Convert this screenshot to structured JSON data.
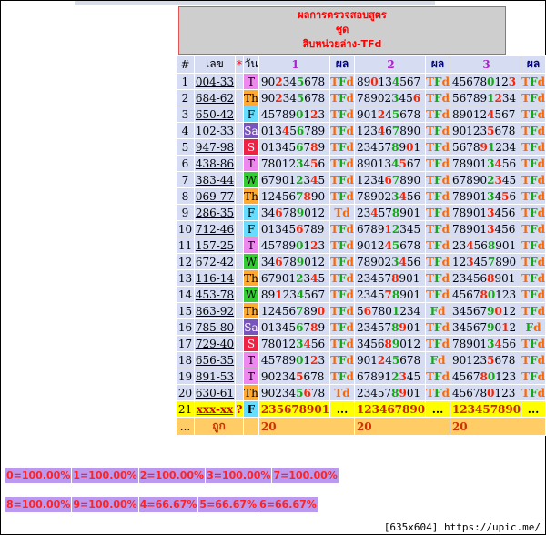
{
  "title": {
    "line1": "ผลการตรวจสอบสูตร",
    "line2": "ชุด",
    "line3": "สิบหน่วยล่าง-TFd"
  },
  "headers": {
    "idx": "#",
    "num": "เลข",
    "star": "*",
    "day": "วัน",
    "set1": "1",
    "score1": "ผล",
    "set2": "2",
    "score2": "ผล",
    "set3": "3",
    "score3": "ผล"
  },
  "colors": {
    "accent_red": "#ff0000",
    "header_bg": "#cecece",
    "row_bg": "#d6ddf3",
    "prediction_bg": "#ffff00",
    "total_bg": "#ffcc66",
    "stat_bg": "#bb99ee"
  },
  "rows": [
    {
      "idx": "1",
      "num": "004-33",
      "day": "T",
      "s1": "902345678",
      "h1": [
        2,
        5
      ],
      "r1": "TFd",
      "s2": "890134567",
      "h2": [
        2,
        5
      ],
      "r2": "TFd",
      "s3": "456780123",
      "h3": [
        8,
        5
      ],
      "r3": "TFd"
    },
    {
      "idx": "2",
      "num": "684-62",
      "day": "Th",
      "s1": "902345678",
      "h1": [
        2,
        5
      ],
      "r1": "TFd",
      "s2": "789023456",
      "h2": [
        8,
        5
      ],
      "r2": "TFd",
      "s3": "567891234",
      "h3": [
        6,
        5
      ],
      "r3": "TFd"
    },
    {
      "idx": "3",
      "num": "650-42",
      "day": "F",
      "s1": "457890123",
      "h1": [
        7,
        5
      ],
      "r1": "TFd",
      "s2": "901245678",
      "h2": [
        3,
        5
      ],
      "r2": "TFd",
      "s3": "890124567",
      "h3": [
        5,
        5
      ],
      "r3": "TFd"
    },
    {
      "idx": "4",
      "num": "102-33",
      "day": "Sa",
      "s1": "013456789",
      "h1": [
        3,
        5
      ],
      "r1": "TFd",
      "s2": "123467890",
      "h2": [
        3,
        5
      ],
      "r2": "TFd",
      "s3": "901235678",
      "h3": [
        5,
        5
      ],
      "r3": "TFd"
    },
    {
      "idx": "5",
      "num": "947-98",
      "day": "S",
      "s1": "013456789",
      "h1": [
        7,
        5
      ],
      "r1": "TFd",
      "s2": "234578901",
      "h2": [
        7,
        5
      ],
      "r2": "TFd",
      "s3": "567891234",
      "h3": [
        4,
        5
      ],
      "r3": "TFd"
    },
    {
      "idx": "6",
      "num": "438-86",
      "day": "T",
      "s1": "780123456",
      "h1": [
        7,
        5
      ],
      "r1": "TFd",
      "s2": "890134567",
      "h2": [
        6,
        5
      ],
      "r2": "TFd",
      "s3": "789013456",
      "h3": [
        6,
        5
      ],
      "r3": "TFd"
    },
    {
      "idx": "7",
      "num": "383-44",
      "day": "W",
      "s1": "679012345",
      "h1": [
        7,
        5
      ],
      "r1": "TFd",
      "s2": "123467890",
      "h2": [
        4,
        5
      ],
      "r2": "TFd",
      "s3": "678902345",
      "h3": [
        6,
        5
      ],
      "r3": "TFd"
    },
    {
      "idx": "8",
      "num": "069-77",
      "day": "Th",
      "s1": "124567890",
      "h1": [
        6,
        5
      ],
      "r1": "TFd",
      "s2": "789023456",
      "h2": [
        6,
        5
      ],
      "r2": "TFd",
      "s3": "789013456",
      "h3": [
        7,
        5
      ],
      "r3": "TFd"
    },
    {
      "idx": "9",
      "num": "286-35",
      "day": "F",
      "s1": "346789012",
      "h1": [
        2,
        5
      ],
      "r1": "Td",
      "s2": "234578901",
      "h2": [
        2,
        5
      ],
      "r2": "TFd",
      "s3": "789013456",
      "h3": [
        5,
        5
      ],
      "r3": "TFd"
    },
    {
      "idx": "10",
      "num": "712-46",
      "day": "F",
      "s1": "013456789",
      "h1": [
        5,
        5
      ],
      "r1": "TFd",
      "s2": "678912345",
      "h2": [
        4,
        5
      ],
      "r2": "TFd",
      "s3": "789013456",
      "h3": [
        5,
        5
      ],
      "r3": "TFd"
    },
    {
      "idx": "11",
      "num": "157-25",
      "day": "T",
      "s1": "457890123",
      "h1": [
        7,
        5
      ],
      "r1": "TFd",
      "s2": "901245678",
      "h2": [
        4,
        5
      ],
      "r2": "TFd",
      "s3": "234568901",
      "h3": [
        2,
        5
      ],
      "r3": "TFd"
    },
    {
      "idx": "12",
      "num": "672-42",
      "day": "W",
      "s1": "346789012",
      "h1": [
        2,
        5
      ],
      "r1": "TFd",
      "s2": "789023456",
      "h2": [
        6,
        5
      ],
      "r2": "TFd",
      "s3": "123457890",
      "h3": [
        2,
        5
      ],
      "r3": "TFd"
    },
    {
      "idx": "13",
      "num": "116-14",
      "day": "Th",
      "s1": "679012345",
      "h1": [
        7,
        5
      ],
      "r1": "TFd",
      "s2": "234578901",
      "h2": [
        5,
        5
      ],
      "r2": "TFd",
      "s3": "234568901",
      "h3": [
        5,
        5
      ],
      "r3": "TFd"
    },
    {
      "idx": "14",
      "num": "453-78",
      "day": "W",
      "s1": "891234567",
      "h1": [
        2,
        5
      ],
      "r1": "TFd",
      "s2": "234578901",
      "h2": [
        4,
        5
      ],
      "r2": "TFd",
      "s3": "456780123",
      "h3": [
        4,
        5
      ],
      "r3": "TFd"
    },
    {
      "idx": "15",
      "num": "863-92",
      "day": "Th",
      "s1": "124567890",
      "h1": [
        8,
        5
      ],
      "r1": "TFd",
      "s2": "567801234",
      "h2": [
        1,
        5
      ],
      "r2": "Fd",
      "s3": "345679012",
      "h3": [
        6,
        5
      ],
      "r3": "TFd"
    },
    {
      "idx": "16",
      "num": "785-80",
      "day": "Sa",
      "s1": "013456789",
      "h1": [
        7,
        5
      ],
      "r1": "TFd",
      "s2": "234578901",
      "h2": [
        6,
        5
      ],
      "r2": "TFd",
      "s3": "345679012",
      "h3": [
        7,
        5
      ],
      "r3": "Fd"
    },
    {
      "idx": "17",
      "num": "729-40",
      "day": "S",
      "s1": "780123456",
      "h1": [
        6,
        5
      ],
      "r1": "TFd",
      "s2": "345689012",
      "h2": [
        4,
        5
      ],
      "r2": "TFd",
      "s3": "789013456",
      "h3": [
        6,
        5
      ],
      "r3": "TFd"
    },
    {
      "idx": "18",
      "num": "656-35",
      "day": "T",
      "s1": "457890123",
      "h1": [
        7,
        5
      ],
      "r1": "TFd",
      "s2": "901245678",
      "h2": [
        3,
        5
      ],
      "r2": "Fd",
      "s3": "901235678",
      "h3": [
        5,
        5
      ],
      "r3": "TFd"
    },
    {
      "idx": "19",
      "num": "891-53",
      "day": "T",
      "s1": "902345678",
      "h1": [
        5,
        5
      ],
      "r1": "TFd",
      "s2": "678912345",
      "h2": [
        6,
        5
      ],
      "r2": "TFd",
      "s3": "456780123",
      "h3": [
        4,
        5
      ],
      "r3": "TFd"
    },
    {
      "idx": "20",
      "num": "630-61",
      "day": "Th",
      "s1": "902345678",
      "h1": [
        6,
        5
      ],
      "r1": "Td",
      "s2": "234578901",
      "h2": [
        6,
        5
      ],
      "r2": "TFd",
      "s3": "456780123",
      "h3": [
        5,
        5
      ],
      "r3": "TFd"
    }
  ],
  "prediction": {
    "idx": "21",
    "num": "xxx-xx",
    "q": "?",
    "day": "F",
    "s1": "235678901",
    "r1": "...",
    "s2": "123467890",
    "r2": "...",
    "s3": "123457890",
    "r3": "..."
  },
  "total": {
    "dots": "...",
    "label": "ถูก",
    "t1": "20",
    "t2": "20",
    "t3": "20"
  },
  "stats_row1": [
    {
      "k": "0",
      "v": "100.00%"
    },
    {
      "k": "1",
      "v": "100.00%"
    },
    {
      "k": "2",
      "v": "100.00%"
    },
    {
      "k": "3",
      "v": "100.00%"
    },
    {
      "k": "7",
      "v": "100.00%"
    }
  ],
  "stats_row2": [
    {
      "k": "8",
      "v": "100.00%"
    },
    {
      "k": "9",
      "v": "100.00%"
    },
    {
      "k": "4",
      "v": "66.67%"
    },
    {
      "k": "5",
      "v": "66.67%"
    },
    {
      "k": "6",
      "v": "66.67%"
    }
  ],
  "watermark": "[635x604] https://upic.me/"
}
